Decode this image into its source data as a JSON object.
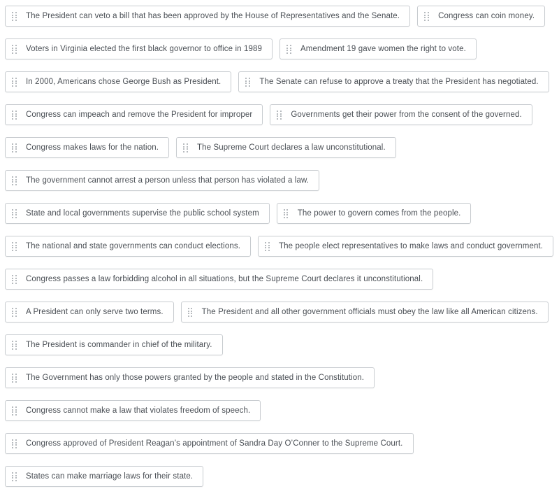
{
  "page": {
    "title": "Sortable Statements",
    "background_color": "#ffffff",
    "chip_border_color": "#c8ccd0",
    "text_color": "#4a4f55",
    "handle_color": "#b6babe",
    "handle_icon": "drag-handle-dots-icon"
  },
  "items": [
    {
      "text": "The President can veto a bill that has been approved by the House of Representatives and the Senate."
    },
    {
      "text": "Congress can coin money."
    },
    {
      "text": "Voters in Virginia elected the first black governor to office in 1989"
    },
    {
      "text": "Amendment 19 gave women the right to vote."
    },
    {
      "text": "In 2000, Americans chose George Bush as President."
    },
    {
      "text": "The Senate can refuse to approve a treaty that the President has negotiated."
    },
    {
      "text": "Congress can impeach and remove the President for improper"
    },
    {
      "text": "Governments get their power from the consent of the governed."
    },
    {
      "text": "Congress makes laws for the nation."
    },
    {
      "text": "The Supreme Court declares a law unconstitutional."
    },
    {
      "text": "The government cannot arrest a person unless that person has violated a law."
    },
    {
      "text": "State and local governments supervise the public school system"
    },
    {
      "text": "The power to govern comes from the people."
    },
    {
      "text": "The national and state governments can conduct elections."
    },
    {
      "text": "The people elect representatives to make laws and conduct government."
    },
    {
      "text": "Congress passes a law forbidding alcohol in all situations, but the Supreme Court declares it unconstitutional."
    },
    {
      "text": "A President can only serve two terms."
    },
    {
      "text": "The President and all other government officials must obey the law like all American citizens."
    },
    {
      "text": "The President is commander in chief of the military."
    },
    {
      "text": "The Government has only those powers granted by the people and stated in the Constitution."
    },
    {
      "text": "Congress cannot make a law that violates freedom of speech."
    },
    {
      "text": "Congress approved of President Reagan’s appointment of Sandra Day O’Conner to the Supreme Court."
    },
    {
      "text": "States can make marriage laws for their state."
    }
  ]
}
